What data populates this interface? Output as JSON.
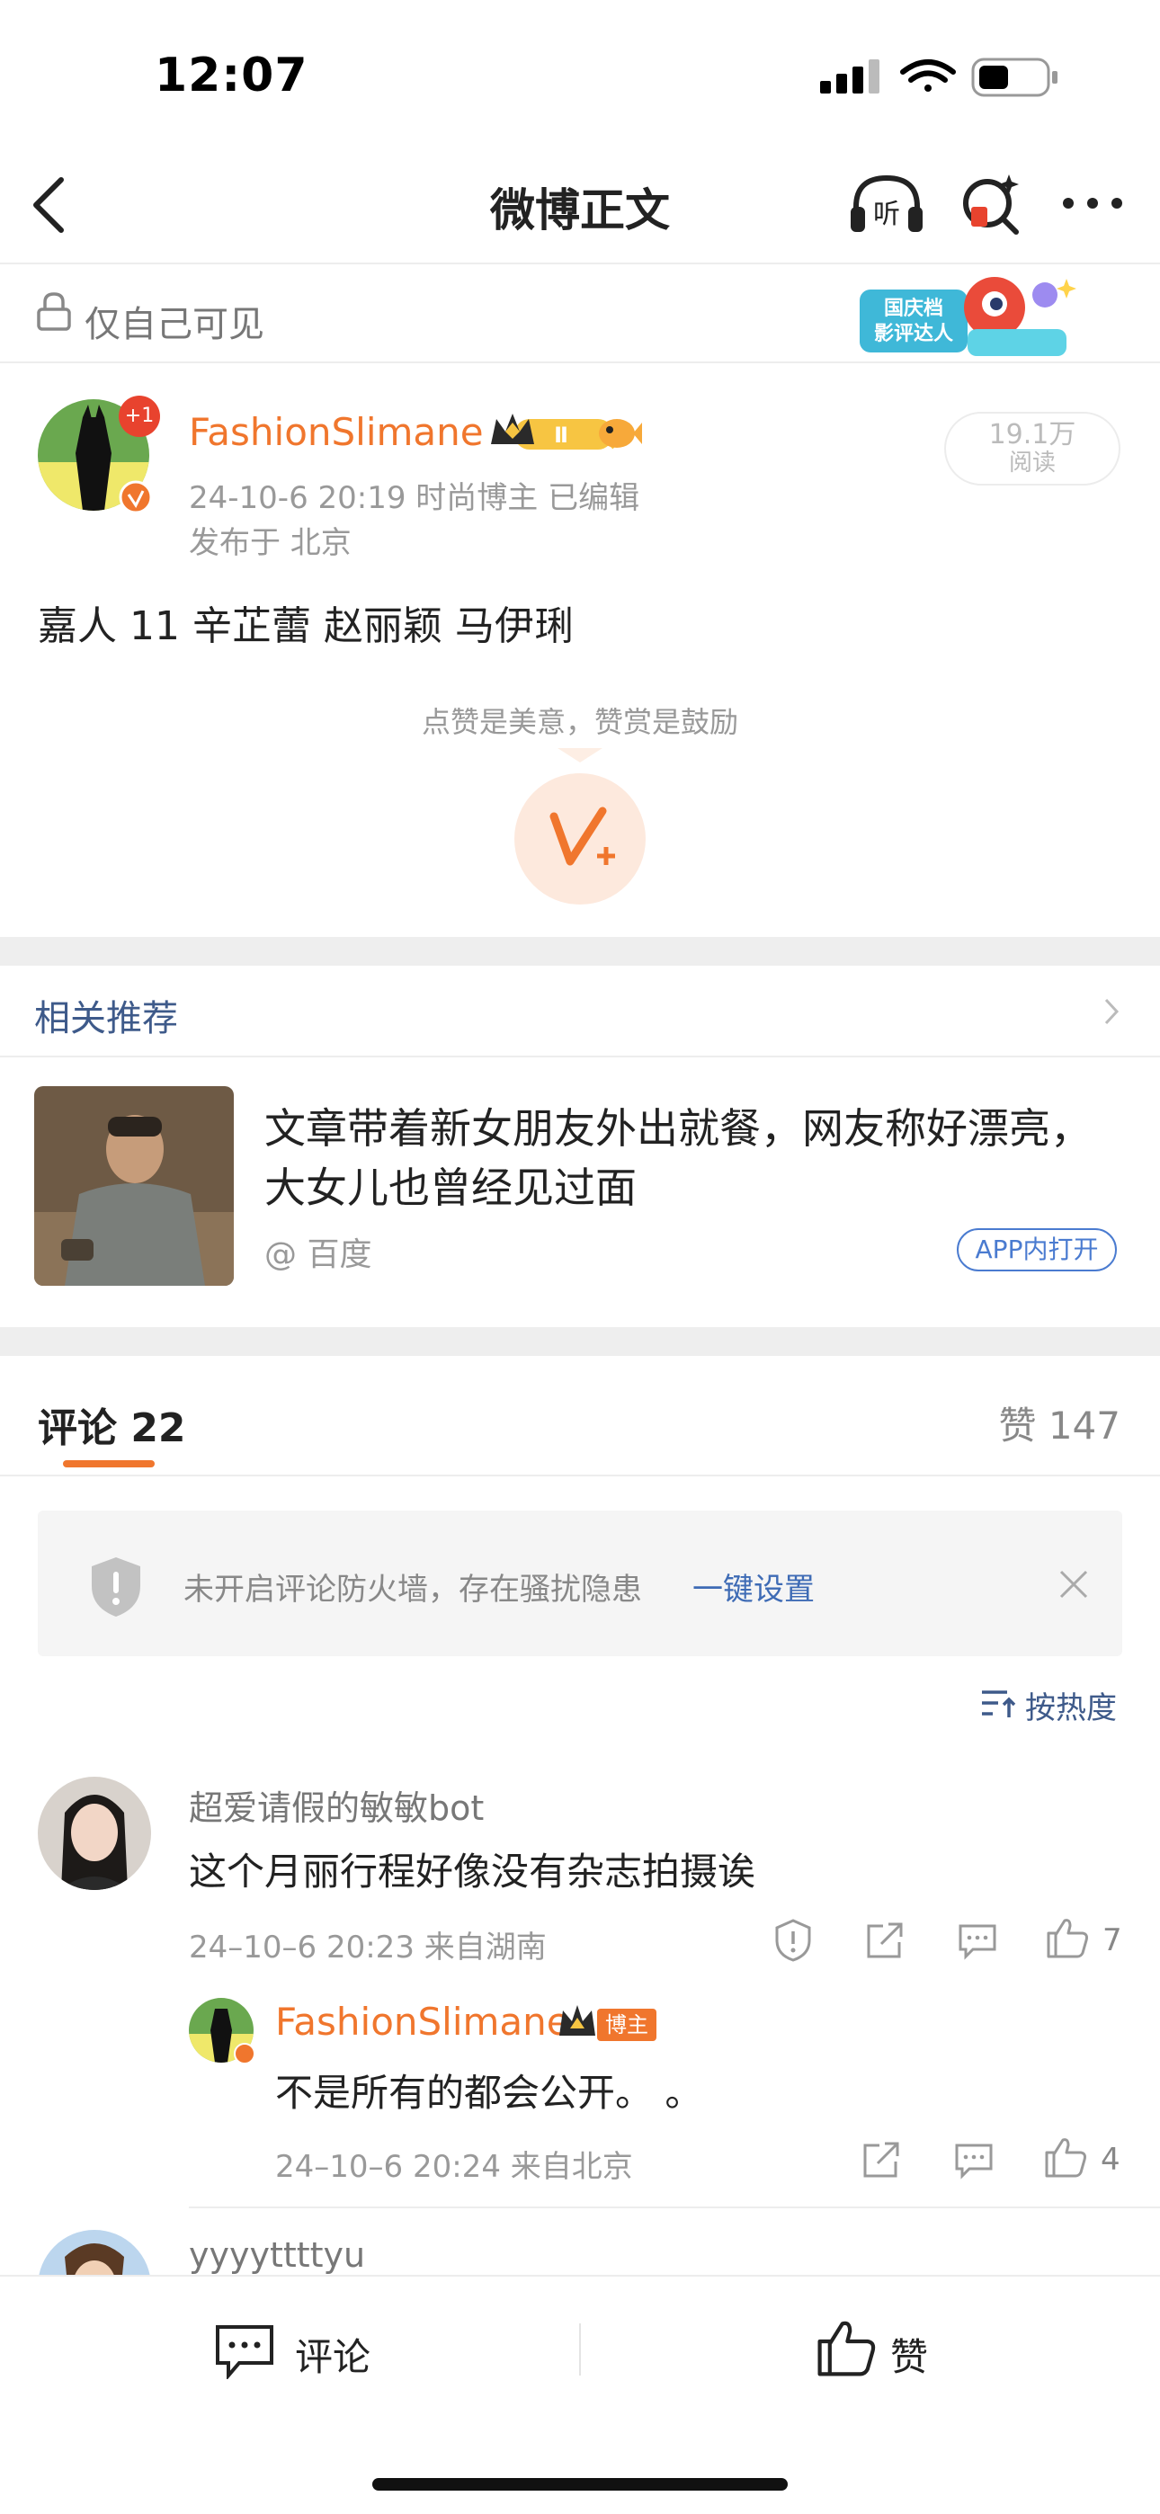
{
  "status_bar": {
    "time": "12:07"
  },
  "nav": {
    "title": "微博正文",
    "listen_label": "听"
  },
  "visibility": {
    "label": "仅自己可见",
    "badge_line1": "国庆档",
    "badge_line2": "影评达人"
  },
  "post": {
    "author": "FashionSlimane",
    "avatar_badge": "+1",
    "level": "Ⅱ",
    "meta": "24-10-6 20:19  时尚博主  已编辑",
    "location": "发布于 北京",
    "reads_count": "19.1万",
    "reads_label": "阅读",
    "text": "嘉人 11 辛芷蕾 赵丽颖 马伊琍",
    "reward_prompt": "点赞是美意，赞赏是鼓励"
  },
  "related": {
    "title": "相关推荐",
    "headline": "文章带着新女朋友外出就餐，网友称好漂亮，大女儿也曾经见过面",
    "source": "@ 百度",
    "open_label": "APP内打开"
  },
  "comments_header": {
    "tab_label": "评论 22",
    "likes_label": "赞 147",
    "firewall_text": "未开启评论防火墙，存在骚扰隐患",
    "firewall_link": "一键设置",
    "sort_label": "按热度"
  },
  "comments": [
    {
      "user": "超爱请假的敏敏bot",
      "text": "这个月丽行程好像没有杂志拍摄诶",
      "meta": "24–10–6 20:23  来自湖南",
      "likes": "7",
      "reply": {
        "user": "FashionSlimane",
        "badge": "博主",
        "text": "不是所有的都会公开。 。",
        "meta": "24–10–6 20:24  来自北京",
        "likes": "4"
      }
    },
    {
      "user": "yyyyttttyu"
    }
  ],
  "bottom_bar": {
    "comment_label": "评论",
    "like_label": "赞"
  },
  "colors": {
    "accent": "#f0762d",
    "link": "#3e6bb5",
    "divider": "#eeeeee"
  }
}
